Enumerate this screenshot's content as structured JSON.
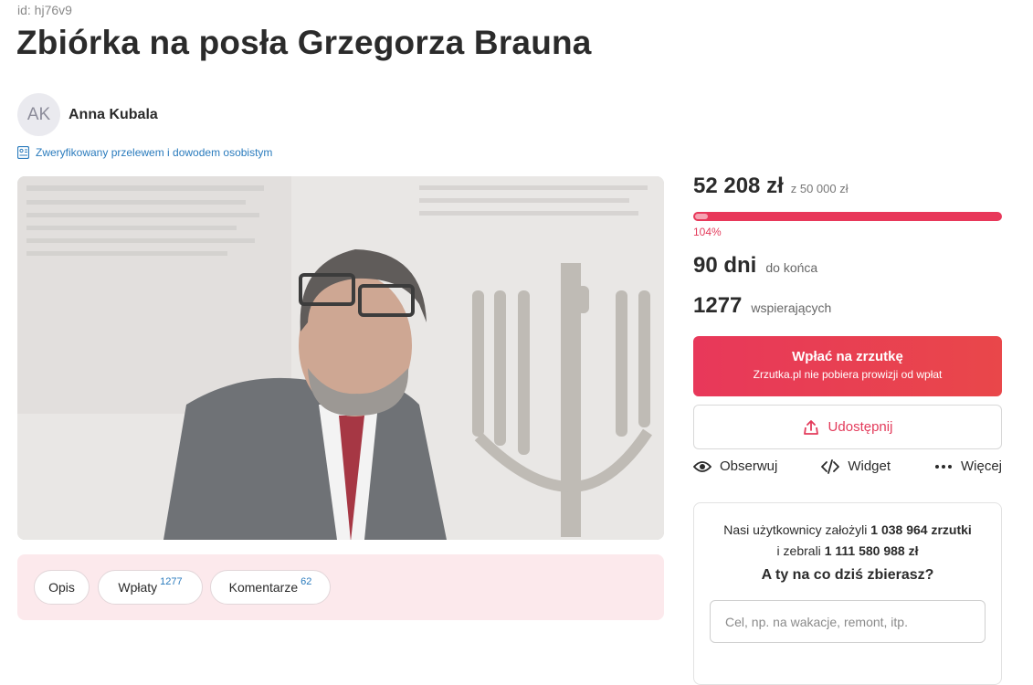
{
  "page": {
    "id_text": "id: hj76v9",
    "title": "Zbiórka na posła Grzegorza Brauna"
  },
  "author": {
    "initials": "AK",
    "name": "Anna Kubala",
    "verified_text": "Zweryfikowany przelewem i dowodem osobistym"
  },
  "tabs": [
    {
      "label": "Opis",
      "count": ""
    },
    {
      "label": "Wpłaty",
      "count": "1277"
    },
    {
      "label": "Komentarze",
      "count": "62"
    }
  ],
  "stats": {
    "raised": "52 208 zł",
    "goal": "z 50 000 zł",
    "percent": "104%",
    "progress_fraction": 1.04,
    "days": "90 dni",
    "days_label": "do końca",
    "supporters": "1277",
    "supporters_label": "wspierających"
  },
  "donate": {
    "label": "Wpłać na zrzutkę",
    "sublabel": "Zrzutka.pl nie pobiera prowizji od wpłat"
  },
  "share": {
    "label": "Udostępnij"
  },
  "actions": [
    {
      "label": "Obserwuj",
      "icon": "eye-icon"
    },
    {
      "label": "Widget",
      "icon": "code-icon"
    },
    {
      "label": "Więcej",
      "icon": "more-icon"
    }
  ],
  "promo": {
    "line1_prefix": "Nasi użytkownicy założyli ",
    "line1_bold": "1 038 964 zrzutki",
    "line2_prefix": "i zebrali ",
    "line2_bold": "1 111 580 988 zł",
    "question": "A ty na co dziś zbierasz?",
    "input_placeholder": "Cel, np. na wakacje, remont, itp.",
    "input_value": ""
  },
  "colors": {
    "accent": "#e8385a",
    "link": "#2a7bbd",
    "tabs_bg": "#fce9ec"
  }
}
